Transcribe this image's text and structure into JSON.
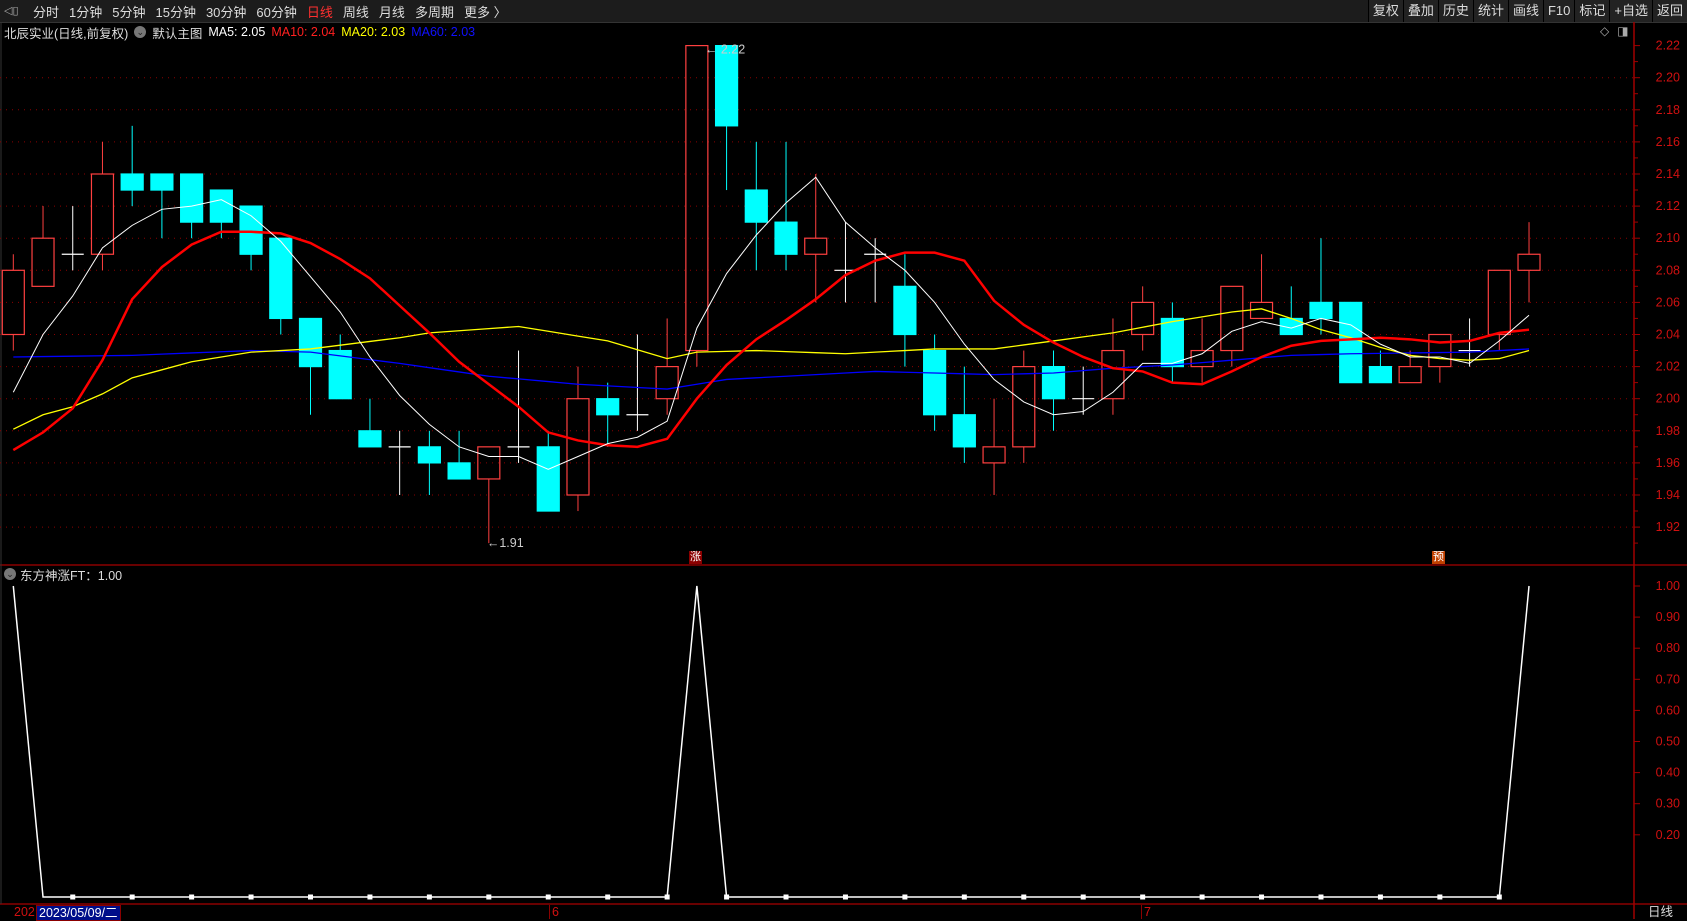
{
  "toolbar": {
    "periods": [
      "分时",
      "1分钟",
      "5分钟",
      "15分钟",
      "30分钟",
      "60分钟",
      "日线",
      "周线",
      "月线",
      "多周期",
      "更多 〉"
    ],
    "active_period": "日线",
    "right_buttons": [
      "复权",
      "叠加",
      "历史",
      "统计",
      "画线",
      "F10",
      "标记",
      "+自选",
      "返回"
    ]
  },
  "header": {
    "title": "北辰实业(日线,前复权)",
    "template": "默认主图",
    "ma5": "MA5: 2.05",
    "ma10": "MA10: 2.04",
    "ma20": "MA20: 2.03",
    "ma60": "MA60: 2.03"
  },
  "indicator": {
    "label": "东方神涨FT：1.00"
  },
  "colors": {
    "up": "#ff4040",
    "down": "#00ffff",
    "ma5": "#ffffff",
    "ma10": "#ff0000",
    "ma20": "#ffff00",
    "ma60": "#0000ff",
    "axis": "#d01010"
  },
  "annotations": {
    "high_label": "2.22",
    "low_label": "1.91",
    "mark_zhang": "涨",
    "mark_yu": "预"
  },
  "date_axis": {
    "left_cut": "202",
    "selected": "2023/05/09/二",
    "month6": "6",
    "month7": "7",
    "period": "日线"
  },
  "chart_data": {
    "type": "candlestick",
    "price_ticks": [
      "2.22",
      "2.20",
      "2.18",
      "2.16",
      "2.14",
      "2.12",
      "2.10",
      "2.08",
      "2.06",
      "2.04",
      "2.02",
      "2.00",
      "1.98",
      "1.96",
      "1.94",
      "1.92"
    ],
    "ylim": [
      1.9,
      2.23
    ],
    "ohlc": [
      [
        2.04,
        2.09,
        2.03,
        2.08
      ],
      [
        2.07,
        2.12,
        2.07,
        2.1
      ],
      [
        2.09,
        2.12,
        2.08,
        2.09
      ],
      [
        2.09,
        2.16,
        2.08,
        2.14
      ],
      [
        2.14,
        2.17,
        2.12,
        2.13
      ],
      [
        2.14,
        2.14,
        2.1,
        2.13
      ],
      [
        2.14,
        2.14,
        2.1,
        2.11
      ],
      [
        2.13,
        2.13,
        2.1,
        2.11
      ],
      [
        2.12,
        2.12,
        2.08,
        2.09
      ],
      [
        2.1,
        2.1,
        2.04,
        2.05
      ],
      [
        2.05,
        2.05,
        1.99,
        2.02
      ],
      [
        2.03,
        2.04,
        2.0,
        2.0
      ],
      [
        1.98,
        2.0,
        1.97,
        1.97
      ],
      [
        1.97,
        1.98,
        1.94,
        1.97
      ],
      [
        1.97,
        1.98,
        1.94,
        1.96
      ],
      [
        1.96,
        1.98,
        1.95,
        1.95
      ],
      [
        1.95,
        1.97,
        1.91,
        1.97
      ],
      [
        1.97,
        2.03,
        1.96,
        1.97
      ],
      [
        1.97,
        1.98,
        1.93,
        1.93
      ],
      [
        1.94,
        2.02,
        1.93,
        2.0
      ],
      [
        2.0,
        2.01,
        1.97,
        1.99
      ],
      [
        1.99,
        2.04,
        1.98,
        1.99
      ],
      [
        2.0,
        2.05,
        1.99,
        2.02
      ],
      [
        2.03,
        2.22,
        2.02,
        2.22
      ],
      [
        2.22,
        2.22,
        2.13,
        2.17
      ],
      [
        2.13,
        2.16,
        2.08,
        2.11
      ],
      [
        2.11,
        2.16,
        2.08,
        2.09
      ],
      [
        2.09,
        2.14,
        2.06,
        2.1
      ],
      [
        2.08,
        2.11,
        2.06,
        2.08
      ],
      [
        2.09,
        2.1,
        2.06,
        2.09
      ],
      [
        2.07,
        2.09,
        2.02,
        2.04
      ],
      [
        2.03,
        2.04,
        1.98,
        1.99
      ],
      [
        1.99,
        2.02,
        1.96,
        1.97
      ],
      [
        1.96,
        2.0,
        1.94,
        1.97
      ],
      [
        1.97,
        2.03,
        1.96,
        2.02
      ],
      [
        2.02,
        2.03,
        1.98,
        2.0
      ],
      [
        2.0,
        2.02,
        1.99,
        2.0
      ],
      [
        2.0,
        2.05,
        1.99,
        2.03
      ],
      [
        2.04,
        2.07,
        2.03,
        2.06
      ],
      [
        2.05,
        2.06,
        2.01,
        2.02
      ],
      [
        2.02,
        2.05,
        2.01,
        2.03
      ],
      [
        2.03,
        2.07,
        2.02,
        2.07
      ],
      [
        2.05,
        2.09,
        2.05,
        2.06
      ],
      [
        2.05,
        2.07,
        2.04,
        2.04
      ],
      [
        2.06,
        2.1,
        2.04,
        2.05
      ],
      [
        2.06,
        2.06,
        2.01,
        2.01
      ],
      [
        2.02,
        2.03,
        2.01,
        2.01
      ],
      [
        2.01,
        2.03,
        2.01,
        2.02
      ],
      [
        2.02,
        2.04,
        2.01,
        2.04
      ],
      [
        2.03,
        2.05,
        2.02,
        2.03
      ],
      [
        2.04,
        2.08,
        2.03,
        2.08
      ],
      [
        2.08,
        2.11,
        2.06,
        2.09
      ]
    ],
    "ma5_head": [
      2.004,
      2.04,
      2.064,
      2.094
    ],
    "ma10_head": [
      1.968,
      1.979,
      1.994,
      2.024,
      2.062,
      2.082,
      2.096,
      2.104,
      2.104
    ],
    "ma20_points": [
      [
        0,
        1.981
      ],
      [
        1,
        1.99
      ],
      [
        2,
        1.995
      ],
      [
        3,
        2.003
      ],
      [
        4,
        2.013
      ],
      [
        6,
        2.023
      ],
      [
        8,
        2.029
      ],
      [
        10,
        2.031
      ],
      [
        13,
        2.038
      ],
      [
        14,
        2.041
      ],
      [
        17,
        2.045
      ],
      [
        20,
        2.036
      ],
      [
        22,
        2.025
      ],
      [
        23,
        2.029
      ],
      [
        25,
        2.03
      ],
      [
        28,
        2.028
      ],
      [
        31,
        2.031
      ],
      [
        33,
        2.031
      ],
      [
        35,
        2.036
      ],
      [
        37,
        2.041
      ],
      [
        39,
        2.048
      ],
      [
        41,
        2.054
      ],
      [
        42,
        2.056
      ],
      [
        43,
        2.05
      ],
      [
        44,
        2.043
      ],
      [
        45,
        2.038
      ],
      [
        46,
        2.032
      ],
      [
        47,
        2.027
      ],
      [
        48,
        2.025
      ],
      [
        49,
        2.024
      ],
      [
        50,
        2.025
      ],
      [
        51,
        2.03
      ]
    ],
    "ma60_points": [
      [
        0,
        2.026
      ],
      [
        4,
        2.027
      ],
      [
        8,
        2.03
      ],
      [
        10,
        2.029
      ],
      [
        13,
        2.022
      ],
      [
        16,
        2.014
      ],
      [
        19,
        2.009
      ],
      [
        22,
        2.006
      ],
      [
        24,
        2.012
      ],
      [
        27,
        2.015
      ],
      [
        29,
        2.017
      ],
      [
        31,
        2.016
      ],
      [
        33,
        2.015
      ],
      [
        35,
        2.016
      ],
      [
        37,
        2.019
      ],
      [
        39,
        2.021
      ],
      [
        41,
        2.024
      ],
      [
        43,
        2.027
      ],
      [
        45,
        2.028
      ],
      [
        49,
        2.029
      ],
      [
        51,
        2.031
      ]
    ],
    "indicator_ticks": [
      "1.00",
      "0.90",
      "0.80",
      "0.70",
      "0.60",
      "0.50",
      "0.40",
      "0.30",
      "0.20"
    ],
    "indicator_signal_indices": [
      0,
      23,
      51
    ]
  }
}
